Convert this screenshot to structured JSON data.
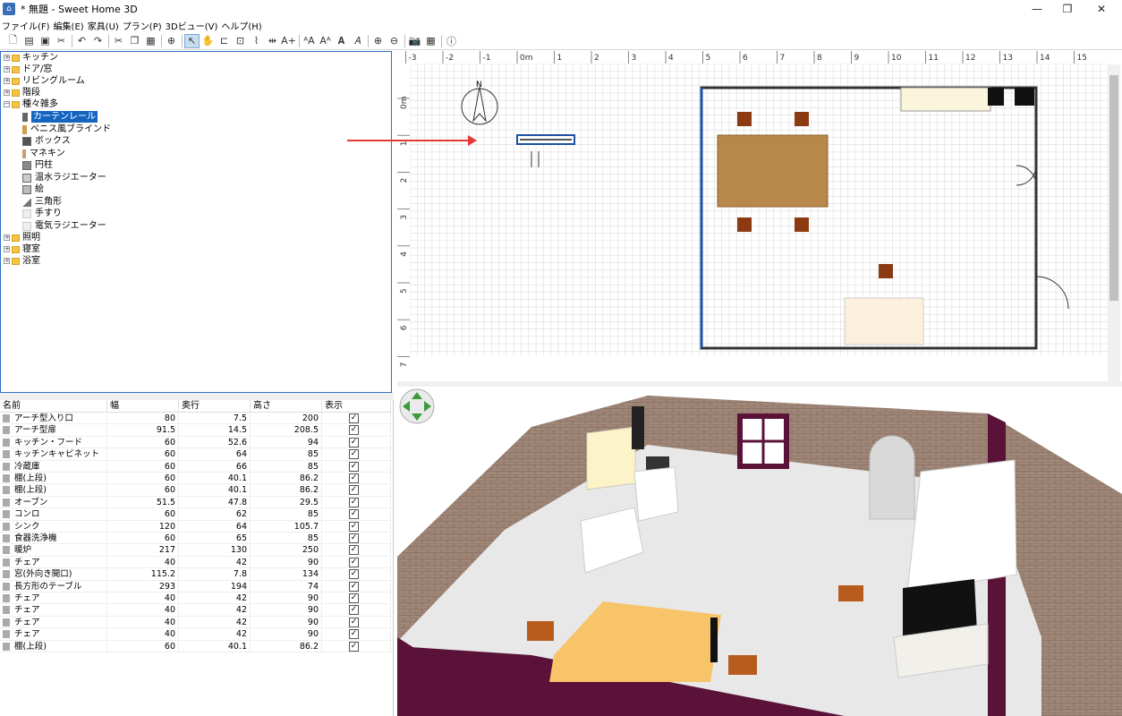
{
  "window": {
    "title": "* 無題 - Sweet Home 3D",
    "minimize": "—",
    "maximize": "❐",
    "close": "✕"
  },
  "menu": [
    "ファイル(F)",
    "編集(E)",
    "家具(U)",
    "プラン(P)",
    "3Dビュー(V)",
    "ヘルプ(H)"
  ],
  "catalog": {
    "items": [
      {
        "label": "キッチン",
        "type": "folder",
        "expanded": false
      },
      {
        "label": "ドア/窓",
        "type": "folder",
        "expanded": false
      },
      {
        "label": "リビングルーム",
        "type": "folder",
        "expanded": false
      },
      {
        "label": "階段",
        "type": "folder",
        "expanded": false
      },
      {
        "label": "種々雑多",
        "type": "folder",
        "expanded": true
      },
      {
        "label": "カーテンレール",
        "type": "leaf",
        "selected": true
      },
      {
        "label": "ベニス風ブラインド",
        "type": "leaf"
      },
      {
        "label": "ボックス",
        "type": "leaf"
      },
      {
        "label": "マネキン",
        "type": "leaf"
      },
      {
        "label": "円柱",
        "type": "leaf"
      },
      {
        "label": "温水ラジエーター",
        "type": "leaf"
      },
      {
        "label": "絵",
        "type": "leaf"
      },
      {
        "label": "三角形",
        "type": "leaf"
      },
      {
        "label": "手すり",
        "type": "leaf"
      },
      {
        "label": "電気ラジエーター",
        "type": "leaf"
      },
      {
        "label": "照明",
        "type": "folder",
        "expanded": false
      },
      {
        "label": "寝室",
        "type": "folder",
        "expanded": false
      },
      {
        "label": "浴室",
        "type": "folder",
        "expanded": false
      }
    ]
  },
  "table": {
    "headers": [
      "名前",
      "幅",
      "奥行",
      "高さ",
      "表示"
    ],
    "rows": [
      [
        "アーチ型入り口",
        "80",
        "7.5",
        "200"
      ],
      [
        "アーチ型扉",
        "91.5",
        "14.5",
        "208.5"
      ],
      [
        "キッチン・フード",
        "60",
        "52.6",
        "94"
      ],
      [
        "キッチンキャビネット",
        "60",
        "64",
        "85"
      ],
      [
        "冷蔵庫",
        "60",
        "66",
        "85"
      ],
      [
        "棚(上段)",
        "60",
        "40.1",
        "86.2"
      ],
      [
        "棚(上段)",
        "60",
        "40.1",
        "86.2"
      ],
      [
        "オーブン",
        "51.5",
        "47.8",
        "29.5"
      ],
      [
        "コンロ",
        "60",
        "62",
        "85"
      ],
      [
        "シンク",
        "120",
        "64",
        "105.7"
      ],
      [
        "食器洗浄機",
        "60",
        "65",
        "85"
      ],
      [
        "暖炉",
        "217",
        "130",
        "250"
      ],
      [
        "チェア",
        "40",
        "42",
        "90"
      ],
      [
        "窓(外向き開口)",
        "115.2",
        "7.8",
        "134"
      ],
      [
        "長方形のテーブル",
        "293",
        "194",
        "74"
      ],
      [
        "チェア",
        "40",
        "42",
        "90"
      ],
      [
        "チェア",
        "40",
        "42",
        "90"
      ],
      [
        "チェア",
        "40",
        "42",
        "90"
      ],
      [
        "チェア",
        "40",
        "42",
        "90"
      ],
      [
        "棚(上段)",
        "60",
        "40.1",
        "86.2"
      ]
    ],
    "check": "✓"
  },
  "plan": {
    "ruler_x": [
      "-3",
      "-2",
      "-1",
      "0m",
      "1",
      "2",
      "3",
      "4",
      "5",
      "6",
      "7",
      "8",
      "9",
      "10",
      "11",
      "12",
      "13",
      "14",
      "15"
    ],
    "ruler_y": [
      "0m",
      "1",
      "2",
      "3",
      "4",
      "5",
      "6",
      "7"
    ],
    "compass_label": "N"
  },
  "colors": {
    "accent": "#1565c0",
    "wall": "#9a7b6a",
    "floor": "#e6e6e6",
    "table": "#b8874a",
    "chair": "#8b3a12",
    "arrow": "#e53935"
  }
}
